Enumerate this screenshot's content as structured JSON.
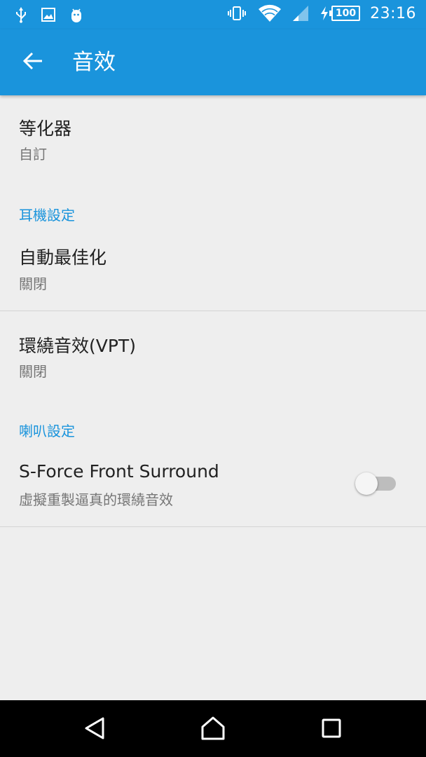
{
  "status_bar": {
    "time": "23:16",
    "battery_level": "100",
    "left_icons": [
      "usb-icon",
      "image-icon",
      "android-debug-icon"
    ],
    "right_icons": [
      "vibrate-icon",
      "wifi-icon",
      "cell-signal-icon",
      "charging-icon",
      "battery-icon"
    ]
  },
  "app_bar": {
    "title": "音效",
    "back_icon": "arrow-back-icon"
  },
  "preferences": {
    "equalizer": {
      "title": "等化器",
      "summary": "自訂"
    },
    "headphone_category": "耳機設定",
    "auto_optimize": {
      "title": "自動最佳化",
      "summary": "關閉"
    },
    "surround_vpt": {
      "title": "環繞音效(VPT)",
      "summary": "關閉"
    },
    "speaker_category": "喇叭設定",
    "sforce": {
      "title": "S-Force Front Surround",
      "summary": "虛擬重製逼真的環繞音效",
      "enabled": false
    }
  },
  "nav_bar": {
    "icons": [
      "back-triangle-icon",
      "home-icon",
      "recents-icon"
    ]
  },
  "colors": {
    "primary": "#1a94dc",
    "background": "#eeeeee",
    "accent_text": "#1a94dc"
  }
}
